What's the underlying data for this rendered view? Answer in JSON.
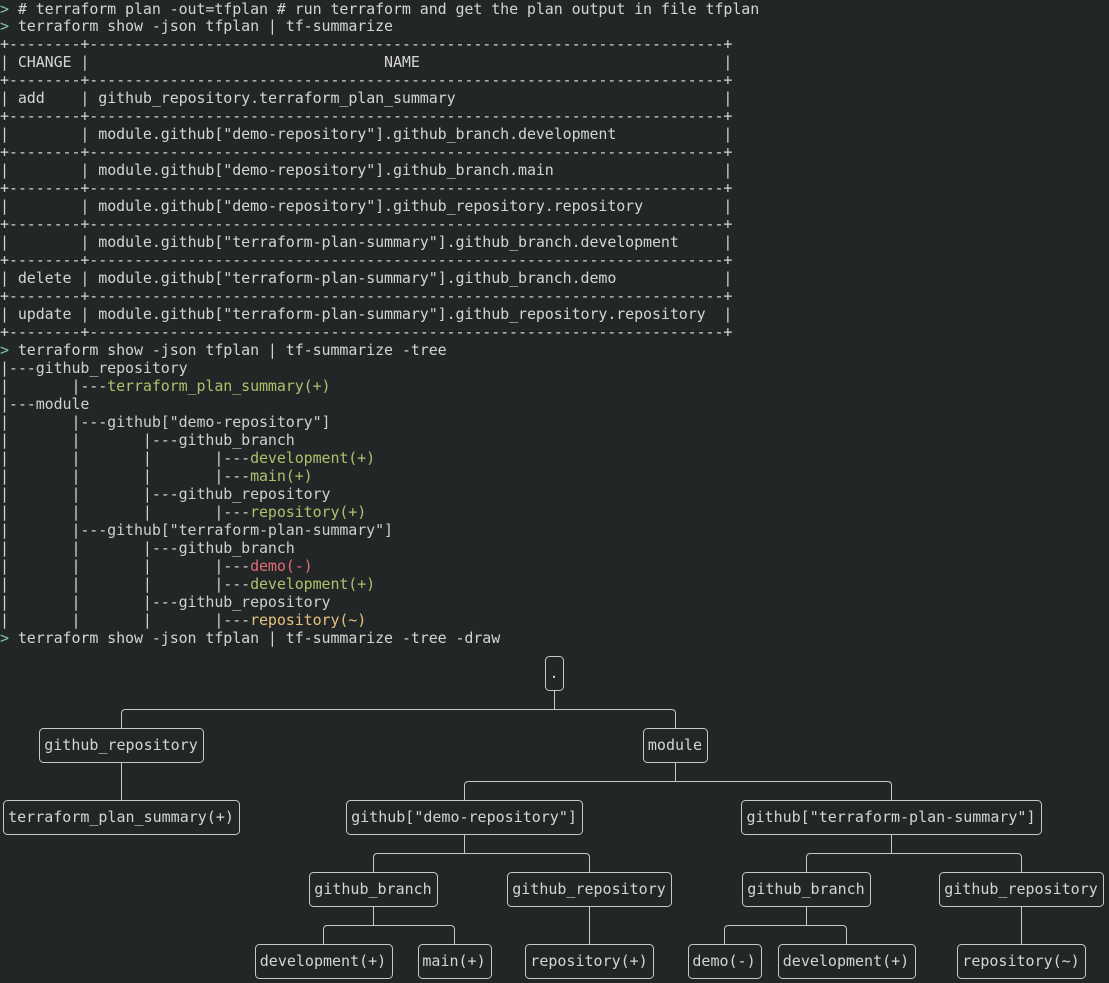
{
  "commands": {
    "plan": "# terraform plan -out=tfplan # run terraform and get the plan output in file tfplan",
    "summarize": "terraform show -json tfplan | tf-summarize",
    "tree": "terraform show -json tfplan | tf-summarize -tree",
    "draw": "terraform show -json tfplan | tf-summarize -tree -draw",
    "prompt_symbol": ">"
  },
  "table": {
    "headers": [
      "CHANGE",
      "NAME"
    ],
    "rows": [
      {
        "change": "add",
        "name": "github_repository.terraform_plan_summary"
      },
      {
        "change": "",
        "name": "module.github[\"demo-repository\"].github_branch.development"
      },
      {
        "change": "",
        "name": "module.github[\"demo-repository\"].github_branch.main"
      },
      {
        "change": "",
        "name": "module.github[\"demo-repository\"].github_repository.repository"
      },
      {
        "change": "",
        "name": "module.github[\"terraform-plan-summary\"].github_branch.development"
      },
      {
        "change": "delete",
        "name": "module.github[\"terraform-plan-summary\"].github_branch.demo"
      },
      {
        "change": "update",
        "name": "module.github[\"terraform-plan-summary\"].github_repository.repository"
      }
    ]
  },
  "tree": [
    {
      "prefix": "|---",
      "label": "github_repository",
      "status": "none"
    },
    {
      "prefix": "|       |---",
      "label": "terraform_plan_summary(+)",
      "status": "add"
    },
    {
      "prefix": "|---",
      "label": "module",
      "status": "none"
    },
    {
      "prefix": "|       |---",
      "label": "github[\"demo-repository\"]",
      "status": "none"
    },
    {
      "prefix": "|       |       |---",
      "label": "github_branch",
      "status": "none"
    },
    {
      "prefix": "|       |       |       |---",
      "label": "development(+)",
      "status": "add"
    },
    {
      "prefix": "|       |       |       |---",
      "label": "main(+)",
      "status": "add"
    },
    {
      "prefix": "|       |       |---",
      "label": "github_repository",
      "status": "none"
    },
    {
      "prefix": "|       |       |       |---",
      "label": "repository(+)",
      "status": "add"
    },
    {
      "prefix": "|       |---",
      "label": "github[\"terraform-plan-summary\"]",
      "status": "none"
    },
    {
      "prefix": "|       |       |---",
      "label": "github_branch",
      "status": "none"
    },
    {
      "prefix": "|       |       |       |---",
      "label": "demo(-)",
      "status": "delete"
    },
    {
      "prefix": "|       |       |       |---",
      "label": "development(+)",
      "status": "add"
    },
    {
      "prefix": "|       |       |---",
      "label": "github_repository",
      "status": "none"
    },
    {
      "prefix": "|       |       |       |---",
      "label": "repository(~)",
      "status": "update"
    }
  ],
  "diagram": {
    "root": ".",
    "nodes": [
      "github_repository",
      "module",
      "terraform_plan_summary(+)",
      "github[\"demo-repository\"]",
      "github[\"terraform-plan-summary\"]",
      "github_branch",
      "github_repository",
      "github_branch",
      "github_repository",
      "development(+)",
      "main(+)",
      "repository(+)",
      "demo(-)",
      "development(+)",
      "repository(~)"
    ]
  },
  "colors": {
    "background": "#232627",
    "text": "#d4d4d4",
    "prompt": "#7ec7a2",
    "add": "#a9c26b",
    "delete": "#e06c75",
    "update": "#e5c07b"
  }
}
